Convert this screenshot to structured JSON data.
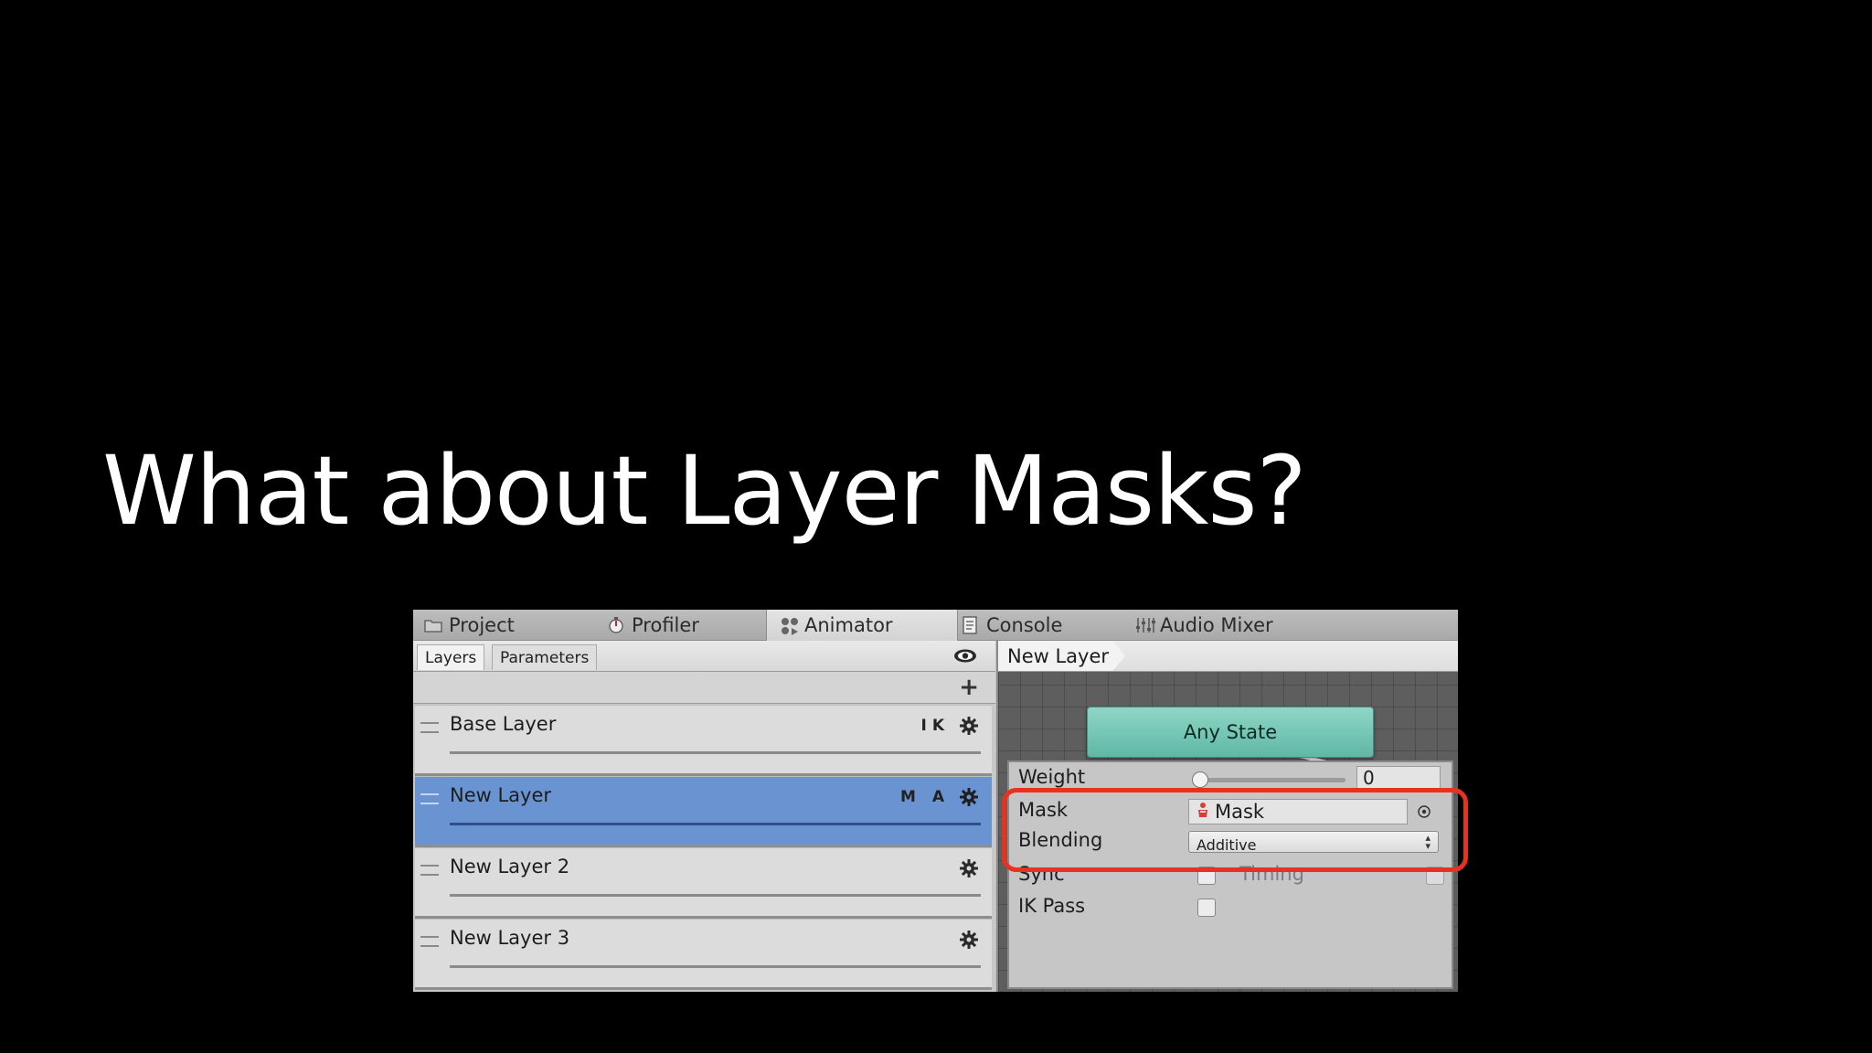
{
  "slide": {
    "title": "What about Layer Masks?"
  },
  "window": {
    "tabs": [
      {
        "label": "Project",
        "icon": "folder-icon"
      },
      {
        "label": "Profiler",
        "icon": "profiler-icon"
      },
      {
        "label": "Animator",
        "icon": "animator-icon",
        "active": true
      },
      {
        "label": "Console",
        "icon": "console-icon"
      },
      {
        "label": "Audio Mixer",
        "icon": "mixer-icon"
      }
    ]
  },
  "left_panel": {
    "subtabs": {
      "layers": "Layers",
      "parameters": "Parameters"
    },
    "add_label": "+",
    "layers": [
      {
        "name": "Base Layer",
        "badges": "IK",
        "selected": false
      },
      {
        "name": "New Layer",
        "badges": "M A",
        "selected": true
      },
      {
        "name": "New Layer 2",
        "badges": "",
        "selected": false
      },
      {
        "name": "New Layer 3",
        "badges": "",
        "selected": false
      }
    ]
  },
  "right_panel": {
    "breadcrumb": "New Layer",
    "any_state": "Any State",
    "settings": {
      "weight_label": "Weight",
      "weight_value": "0",
      "weight_fraction": 0,
      "mask_label": "Mask",
      "mask_value": "Mask",
      "blending_label": "Blending",
      "blending_value": "Additive",
      "sync_label": "Sync",
      "timing_label": "Timing",
      "ik_pass_label": "IK Pass"
    }
  },
  "colors": {
    "selected_layer": "#6a93d2",
    "any_state": "#6cc2ae",
    "highlight": "#e8321f"
  }
}
